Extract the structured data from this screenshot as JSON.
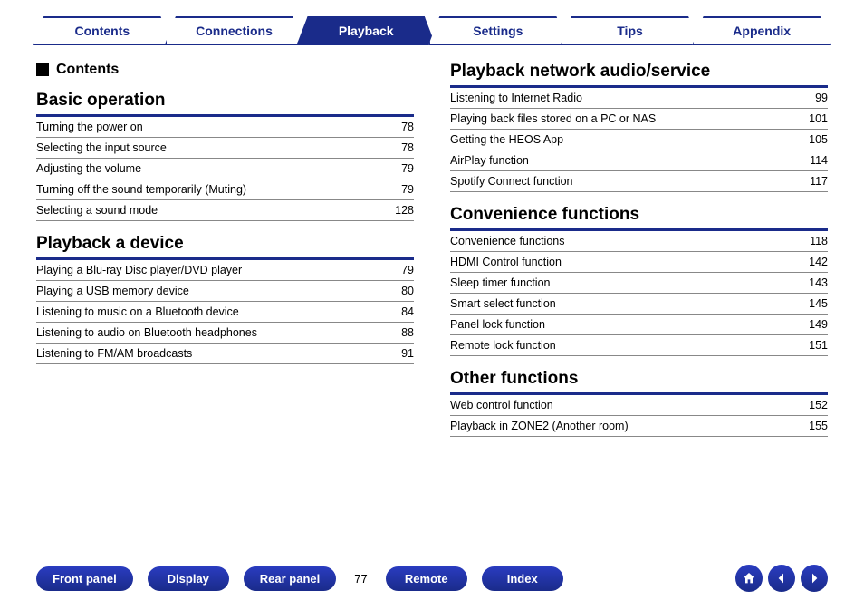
{
  "tabs": [
    "Contents",
    "Connections",
    "Playback",
    "Settings",
    "Tips",
    "Appendix"
  ],
  "activeTab": 2,
  "contentsHeader": "Contents",
  "left": [
    {
      "title": "Basic operation",
      "items": [
        {
          "label": "Turning the power on",
          "pg": "78"
        },
        {
          "label": "Selecting the input source",
          "pg": "78"
        },
        {
          "label": "Adjusting the volume",
          "pg": "79"
        },
        {
          "label": "Turning off the sound temporarily (Muting)",
          "pg": "79"
        },
        {
          "label": "Selecting a sound mode",
          "pg": "128"
        }
      ]
    },
    {
      "title": "Playback a device",
      "items": [
        {
          "label": "Playing a Blu-ray Disc player/DVD player",
          "pg": "79"
        },
        {
          "label": "Playing a USB memory device",
          "pg": "80"
        },
        {
          "label": "Listening to music on a Bluetooth device",
          "pg": "84"
        },
        {
          "label": "Listening to audio on Bluetooth headphones",
          "pg": "88"
        },
        {
          "label": "Listening to FM/AM broadcasts",
          "pg": "91"
        }
      ]
    }
  ],
  "right": [
    {
      "title": "Playback network audio/service",
      "items": [
        {
          "label": "Listening to Internet Radio",
          "pg": "99"
        },
        {
          "label": "Playing back files stored on a PC or NAS",
          "pg": "101"
        },
        {
          "label": "Getting the HEOS App",
          "pg": "105"
        },
        {
          "label": "AirPlay function",
          "pg": "114"
        },
        {
          "label": "Spotify Connect function",
          "pg": "117"
        }
      ]
    },
    {
      "title": "Convenience functions",
      "items": [
        {
          "label": "Convenience functions",
          "pg": "118"
        },
        {
          "label": "HDMI Control function",
          "pg": "142"
        },
        {
          "label": "Sleep timer function",
          "pg": "143"
        },
        {
          "label": "Smart select function",
          "pg": "145"
        },
        {
          "label": "Panel lock function",
          "pg": "149"
        },
        {
          "label": "Remote lock function",
          "pg": "151"
        }
      ]
    },
    {
      "title": "Other functions",
      "items": [
        {
          "label": "Web control function",
          "pg": "152"
        },
        {
          "label": "Playback in ZONE2 (Another room)",
          "pg": "155"
        }
      ]
    }
  ],
  "footer": {
    "pills": [
      "Front panel",
      "Display",
      "Rear panel"
    ],
    "pageNumber": "77",
    "pillsRight": [
      "Remote",
      "Index"
    ]
  }
}
